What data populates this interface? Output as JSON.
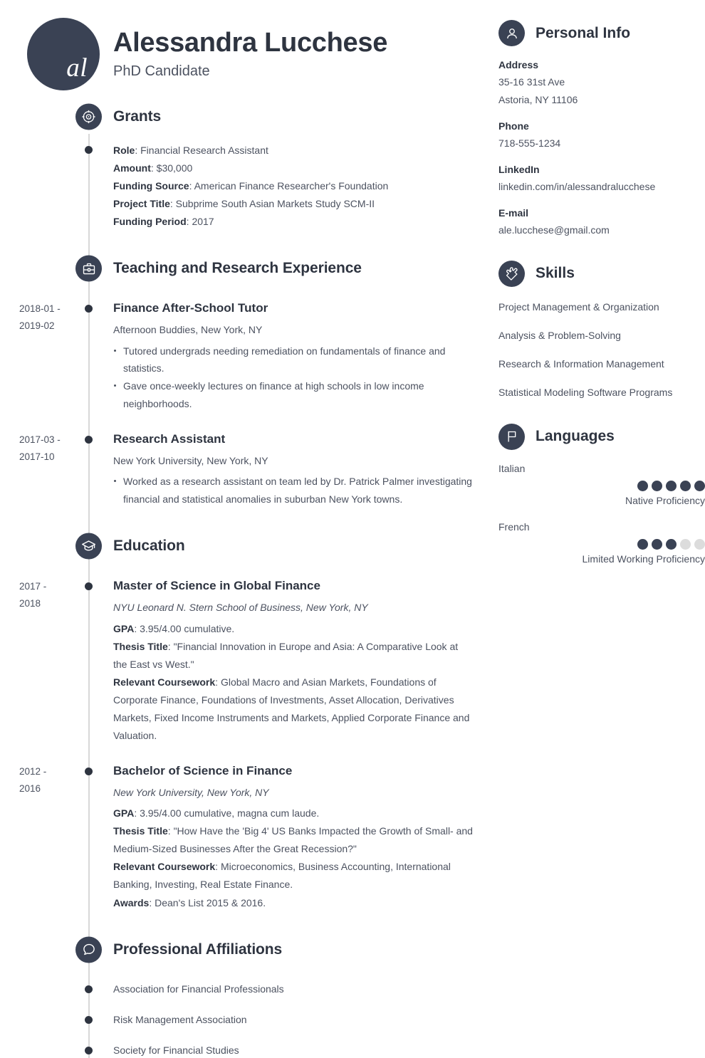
{
  "header": {
    "monogram": "al",
    "name": "Alessandra Lucchese",
    "title": "PhD Candidate"
  },
  "colors": {
    "accent_dark": "#3a4254",
    "text_dark": "#2e3440",
    "text_body": "#4c5260",
    "timeline_line": "#d8d8d8",
    "dot_empty": "#dcdcdc"
  },
  "sections": {
    "grants": {
      "title": "Grants",
      "icon": "target-icon",
      "items": [
        {
          "label": "Role",
          "value": "Financial Research Assistant"
        },
        {
          "label": "Amount",
          "value": "$30,000"
        },
        {
          "label": "Funding Source",
          "value": "American Finance Researcher's Foundation"
        },
        {
          "label": "Project Title",
          "value": "Subprime South Asian Markets Study SCM-II"
        },
        {
          "label": "Funding Period",
          "value": "2017"
        }
      ]
    },
    "experience": {
      "title": "Teaching and Research Experience",
      "icon": "briefcase-icon",
      "entries": [
        {
          "date_from": "2018-01 -",
          "date_to": "2019-02",
          "title": "Finance After-School Tutor",
          "subtitle": "Afternoon Buddies, New York, NY",
          "bullets": [
            "Tutored undergrads needing remediation on fundamentals of finance and statistics.",
            "Gave once-weekly lectures on finance at high schools in low income neighborhoods."
          ]
        },
        {
          "date_from": "2017-03 -",
          "date_to": "2017-10",
          "title": "Research Assistant",
          "subtitle": "New York University, New York, NY",
          "bullets": [
            "Worked as a research assistant on team led by Dr. Patrick Palmer investigating financial and statistical anomalies in suburban New York towns."
          ]
        }
      ]
    },
    "education": {
      "title": "Education",
      "icon": "graduation-cap-icon",
      "entries": [
        {
          "date_from": "2017 -",
          "date_to": "2018",
          "title": "Master of Science in Global Finance",
          "subtitle": "NYU Leonard N. Stern School of Business, New York, NY",
          "details": [
            {
              "label": "GPA",
              "value": "3.95/4.00 cumulative."
            },
            {
              "label": "Thesis Title",
              "value": "\"Financial Innovation in Europe and Asia: A Comparative Look at the East vs West.\""
            },
            {
              "label": "Relevant Coursework",
              "value": "Global Macro and Asian Markets, Foundations of Corporate Finance, Foundations of Investments, Asset Allocation, Derivatives Markets, Fixed Income Instruments and Markets, Applied Corporate Finance and Valuation."
            }
          ]
        },
        {
          "date_from": "2012 -",
          "date_to": "2016",
          "title": "Bachelor of Science in Finance",
          "subtitle": "New York University, New York, NY",
          "details": [
            {
              "label": "GPA",
              "value": "3.95/4.00 cumulative, magna cum laude."
            },
            {
              "label": "Thesis Title",
              "value": "\"How Have the 'Big 4' US Banks Impacted the Growth of Small- and Medium-Sized Businesses After the Great Recession?\""
            },
            {
              "label": "Relevant Coursework",
              "value": "Microeconomics, Business Accounting, International Banking, Investing, Real Estate Finance."
            },
            {
              "label": "Awards",
              "value": "Dean's List 2015 & 2016."
            }
          ]
        }
      ]
    },
    "affiliations": {
      "title": "Professional Affiliations",
      "icon": "speech-bubble-icon",
      "items": [
        "Association for Financial Professionals",
        "Risk Management Association",
        "Society for Financial Studies"
      ]
    }
  },
  "sidebar": {
    "personal_info": {
      "title": "Personal Info",
      "icon": "person-icon",
      "fields": [
        {
          "label": "Address",
          "lines": [
            "35-16 31st Ave",
            "Astoria, NY 11106"
          ]
        },
        {
          "label": "Phone",
          "lines": [
            "718-555-1234"
          ]
        },
        {
          "label": "LinkedIn",
          "lines": [
            "linkedin.com/in/alessandralucchese"
          ]
        },
        {
          "label": "E-mail",
          "lines": [
            "ale.lucchese@gmail.com"
          ]
        }
      ]
    },
    "skills": {
      "title": "Skills",
      "icon": "puzzle-piece-icon",
      "items": [
        "Project Management & Organization",
        "Analysis & Problem-Solving",
        "Research & Information Management",
        "Statistical Modeling Software Programs"
      ]
    },
    "languages": {
      "title": "Languages",
      "icon": "flag-icon",
      "items": [
        {
          "name": "Italian",
          "level": "Native Proficiency",
          "filled": 5,
          "total": 5
        },
        {
          "name": "French",
          "level": "Limited Working Proficiency",
          "filled": 3,
          "total": 5
        }
      ]
    }
  }
}
